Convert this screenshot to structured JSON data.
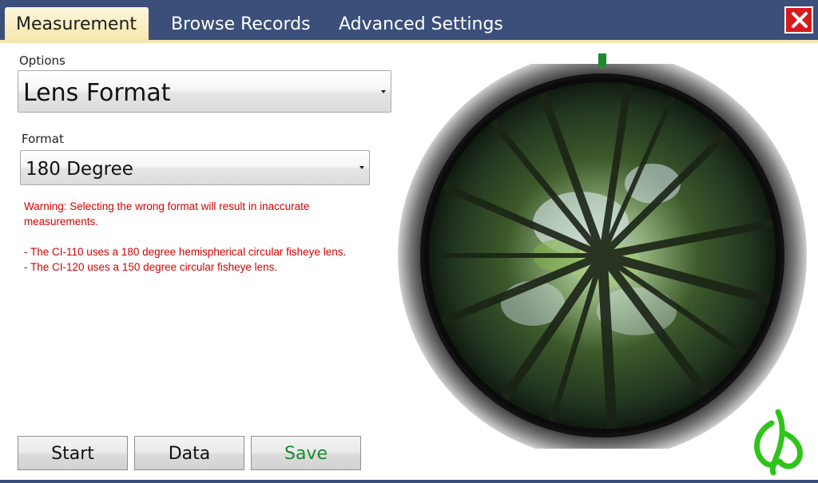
{
  "tabs": [
    {
      "label": "Measurement",
      "active": true
    },
    {
      "label": "Browse Records",
      "active": false
    },
    {
      "label": "Advanced Settings",
      "active": false
    }
  ],
  "close_icon": "close-x-icon",
  "options": {
    "label": "Options",
    "selected": "Lens Format"
  },
  "format": {
    "label": "Format",
    "selected": "180 Degree"
  },
  "warning": {
    "line1": "Warning: Selecting the wrong format will result in inaccurate",
    "line2": "measurements.",
    "note1": "- The CI-110 uses a 180 degree hemispherical circular fisheye lens.",
    "note2": "- The CI-120 uses a 150 degree circular fisheye lens."
  },
  "buttons": {
    "start": "Start",
    "data": "Data",
    "save": "Save"
  },
  "colors": {
    "header": "#3b4f7a",
    "active_tab": "#f7e7ad",
    "warning": "#d40000",
    "save_text": "#1a8a2a",
    "close": "#d71b1b",
    "marker": "#1c8a2d",
    "logo": "#2ec41a"
  },
  "icons": {
    "logo": "leaf-logo-icon",
    "lens_marker": "north-marker-icon"
  }
}
